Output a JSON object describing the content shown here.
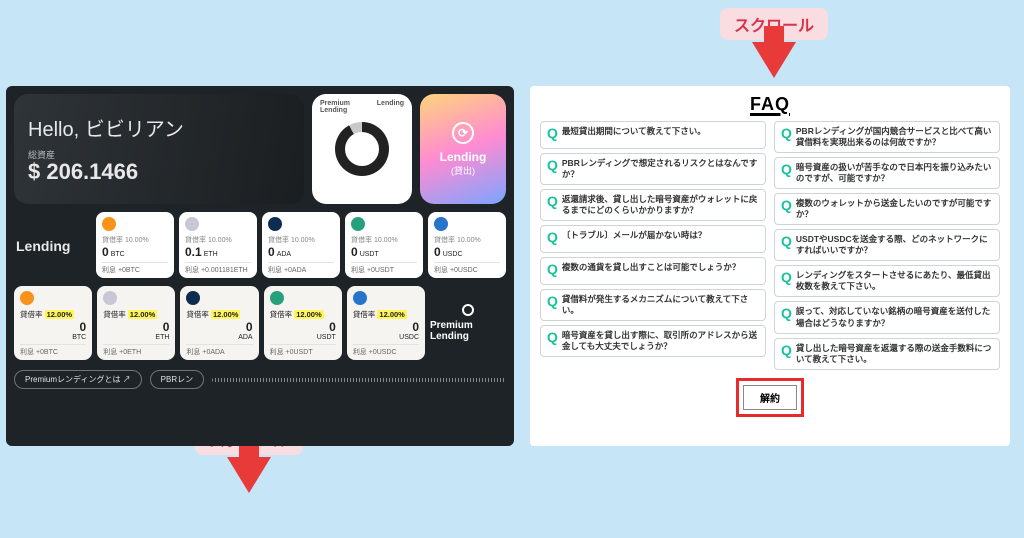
{
  "callouts": {
    "label": "スクロール"
  },
  "dashboard": {
    "hello_prefix": "Hello, ",
    "username": "ビビリアン",
    "asset_label": "総資産",
    "asset_amount": "$ 206.1466",
    "donut": {
      "left": "Premium Lending",
      "right": "Lending"
    },
    "lending_card": {
      "title": "Lending",
      "sub": "(貸出)"
    },
    "lending_section": "Lending",
    "premium_section": "Premium Lending",
    "rate_label_prefix": "貸借率 ",
    "interest_prefix": "利息 ",
    "assets": [
      {
        "sym": "BTC",
        "icon": "ic-btc",
        "rate": "10.00%",
        "amount": "0",
        "interest": "+0BTC"
      },
      {
        "sym": "ETH",
        "icon": "ic-eth",
        "rate": "10.00%",
        "amount": "0.1",
        "interest": "+0.001181ETH"
      },
      {
        "sym": "ADA",
        "icon": "ic-ada",
        "rate": "10.00%",
        "amount": "0",
        "interest": "+0ADA"
      },
      {
        "sym": "USDT",
        "icon": "ic-usdt",
        "rate": "10.00%",
        "amount": "0",
        "interest": "+0USDT"
      },
      {
        "sym": "USDC",
        "icon": "ic-usdc",
        "rate": "10.00%",
        "amount": "0",
        "interest": "+0USDC"
      }
    ],
    "premium_assets": [
      {
        "sym": "BTC",
        "icon": "ic-btc",
        "rate": "12.00%",
        "amount": "0",
        "interest": "+0BTC"
      },
      {
        "sym": "ETH",
        "icon": "ic-eth",
        "rate": "12.00%",
        "amount": "0",
        "interest": "+0ETH"
      },
      {
        "sym": "ADA",
        "icon": "ic-ada",
        "rate": "12.00%",
        "amount": "0",
        "interest": "+0ADA"
      },
      {
        "sym": "USDT",
        "icon": "ic-usdt",
        "rate": "12.00%",
        "amount": "0",
        "interest": "+0USDT"
      },
      {
        "sym": "USDC",
        "icon": "ic-usdc",
        "rate": "12.00%",
        "amount": "0",
        "interest": "+0USDC"
      }
    ],
    "links": {
      "premium_about": "Premiumレンディングとは ↗",
      "pbr_about": "PBRレン"
    }
  },
  "faq": {
    "title": "FAQ",
    "left": [
      "最短貸出期間について教えて下さい。",
      "PBRレンディングで想定されるリスクとはなんですか？",
      "返還請求後、貸し出した暗号資産がウォレットに戻るまでにどのくらいかかりますか？",
      "〔トラブル〕メールが届かない時は？",
      "複数の通貨を貸し出すことは可能でしょうか？",
      "貸借料が発生するメカニズムについて教えて下さい。",
      "暗号資産を貸し出す際に、取引所のアドレスから送金しても大丈夫でしょうか？"
    ],
    "right": [
      "PBRレンディングが国内競合サービスと比べて高い貸借料を実現出来るのは何故ですか？",
      "暗号資産の扱いが苦手なので日本円を振り込みたいのですが、可能ですか？",
      "複数のウォレットから送金したいのですが可能ですか？",
      "USDTやUSDCを送金する際、どのネットワークにすればいいですか？",
      "レンディングをスタートさせるにあたり、最低貸出枚数を教えて下さい。",
      "誤って、対応していない銘柄の暗号資産を送付した場合はどうなりますか？",
      "貸し出した暗号資産を返還する際の送金手数料について教えて下さい。"
    ],
    "cancel": "解約"
  }
}
